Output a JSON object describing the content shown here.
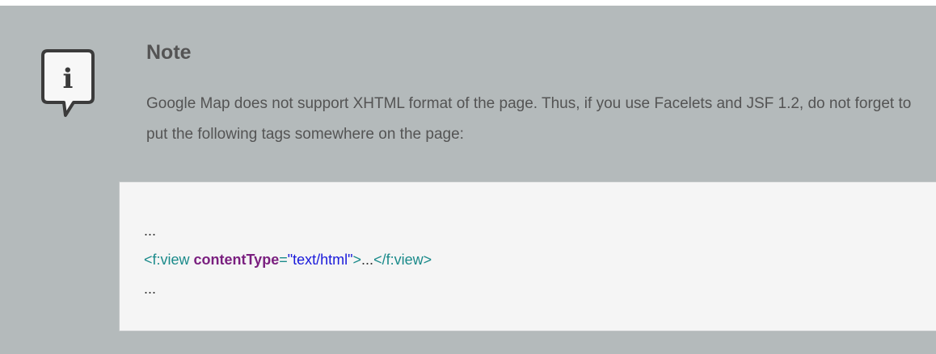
{
  "note": {
    "title": "Note",
    "text": "Google Map does not support XHTML format of the page. Thus, if you use Facelets and JSF 1.2, do not forget to put the following tags somewhere on the page:",
    "icon": "info-icon",
    "icon_letter": "i"
  },
  "code": {
    "line1": "...",
    "line2": {
      "open_tag": "<f:view ",
      "attr_name": "contentType",
      "equals": "=",
      "attr_value": "\"text/html\"",
      "close_bracket": ">",
      "content": "...",
      "end_tag": "</f:view>"
    },
    "line3": "..."
  },
  "colors": {
    "background": "#b4babb",
    "code_background": "#f5f5f5",
    "text": "#545454",
    "tag": "#1a8a8a",
    "attribute": "#7a1f7f",
    "value": "#1a1adb"
  }
}
